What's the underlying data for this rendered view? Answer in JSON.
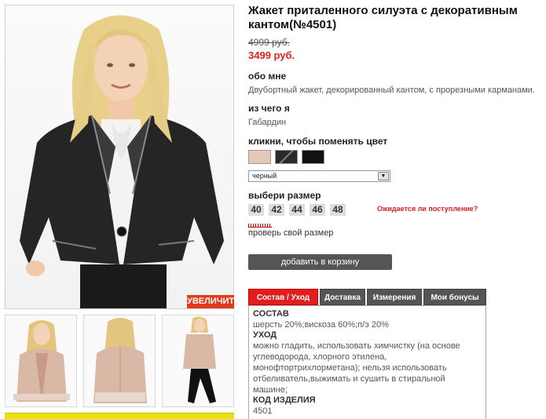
{
  "product": {
    "title": "Жакет приталенного силуэта с декоративным кантом(№4501)",
    "old_price": "4999 руб.",
    "new_price": "3499 руб."
  },
  "about": {
    "heading": "обо мне",
    "text": "Двубортный жакет, декорированный кантом, с прорезными карманами."
  },
  "material": {
    "heading": "из чего я",
    "text": "Габардин"
  },
  "color": {
    "heading": "кликни, чтобы поменять цвет",
    "swatches": [
      "#e3c9b5",
      "#2a2a2a",
      "#111111"
    ],
    "selected": "черный"
  },
  "size": {
    "heading": "выбери размер",
    "options": [
      "40",
      "42",
      "44",
      "46",
      "48"
    ],
    "awaiting_link": "Ожидается ли поступление?",
    "check_size": "проверь свой размер"
  },
  "zoom_label": "УВЕЛИЧИТЬ",
  "cart_button": "добавить в корзину",
  "tabs": [
    "Состав / Уход",
    "Доставка",
    "Измерения",
    "Мои бонусы"
  ],
  "composition": {
    "h1": "СОСТАВ",
    "t1": "шерсть 20%;вискоза 60%;п/э 20%",
    "h2": "УХОД",
    "t2_lines": [
      "можно гладить, использовать химчистку (на основе",
      "углеводорода, хлорного этилена,",
      "монофтортрихлорметана); нельзя использовать",
      "отбеливатель,выжимать и сушить в стиральной",
      "машине;"
    ],
    "h3": "КОД ИЗДЕЛИЯ",
    "t3": "4501"
  },
  "colors": {
    "accent": "#e21d1d",
    "button": "#555555",
    "banner": "#e9e300"
  }
}
